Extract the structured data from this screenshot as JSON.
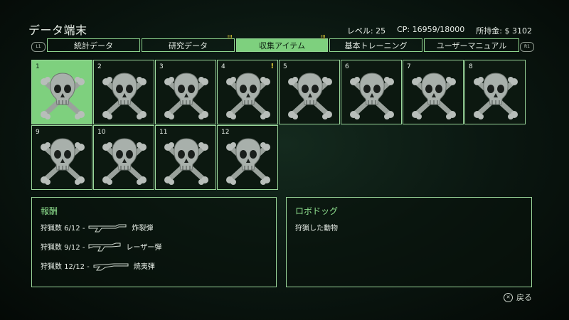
{
  "header": {
    "title": "データ端末",
    "level": "レベル: 25",
    "cp": "CP: 16959/18000",
    "money": "所持金: $ 3102"
  },
  "tabs": [
    {
      "label": "統計データ",
      "active": false,
      "notify": ""
    },
    {
      "label": "研究データ",
      "active": false,
      "notify": "!!!"
    },
    {
      "label": "収集アイテム",
      "active": true,
      "notify": "!!!"
    },
    {
      "label": "基本トレーニング",
      "active": false,
      "notify": ""
    },
    {
      "label": "ユーザーマニュアル",
      "active": false,
      "notify": ""
    }
  ],
  "shoulders": {
    "left": "L1",
    "right": "R1"
  },
  "items": [
    {
      "num": "1",
      "selected": true,
      "alert": ""
    },
    {
      "num": "2",
      "selected": false,
      "alert": ""
    },
    {
      "num": "3",
      "selected": false,
      "alert": ""
    },
    {
      "num": "4",
      "selected": false,
      "alert": "!"
    },
    {
      "num": "5",
      "selected": false,
      "alert": ""
    },
    {
      "num": "6",
      "selected": false,
      "alert": ""
    },
    {
      "num": "7",
      "selected": false,
      "alert": ""
    },
    {
      "num": "8",
      "selected": false,
      "alert": ""
    },
    {
      "num": "9",
      "selected": false,
      "alert": ""
    },
    {
      "num": "10",
      "selected": false,
      "alert": ""
    },
    {
      "num": "11",
      "selected": false,
      "alert": ""
    },
    {
      "num": "12",
      "selected": false,
      "alert": ""
    }
  ],
  "rewards": {
    "title": "報酬",
    "rows": [
      {
        "count": "狩猟数 6/12 -",
        "weapon_icon": "rifle-icon",
        "name": "炸裂弾"
      },
      {
        "count": "狩猟数 9/12 -",
        "weapon_icon": "laser-gun-icon",
        "name": "レーザー弾"
      },
      {
        "count": "狩猟数 12/12 -",
        "weapon_icon": "shotgun-icon",
        "name": "焼夷弾"
      }
    ]
  },
  "info": {
    "title": "ロボドッグ",
    "text": "狩猟した動物"
  },
  "footer": {
    "button_icon": "circle-button-icon",
    "back_label": "戻る"
  },
  "colors": {
    "accent": "#7ed07e",
    "border": "#9ad69a",
    "notify": "#e6d23a"
  }
}
